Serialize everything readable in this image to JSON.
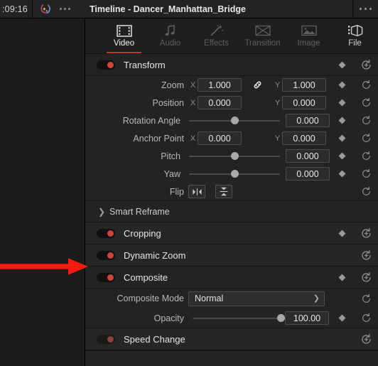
{
  "left_panel": {
    "timecode": ":09:16",
    "ai_icon": "magic-sparkle-icon",
    "options_icon": "ellipsis-icon"
  },
  "inspector": {
    "title": "Timeline - Dancer_Manhattan_Bridge",
    "header_options_icon": "ellipsis-icon",
    "tabs": [
      {
        "label": "Video",
        "icon": "film-strip-icon",
        "state": "active"
      },
      {
        "label": "Audio",
        "icon": "music-note-icon",
        "state": "disabled"
      },
      {
        "label": "Effects",
        "icon": "magic-wand-icon",
        "state": "disabled"
      },
      {
        "label": "Transition",
        "icon": "transition-icon",
        "state": "disabled"
      },
      {
        "label": "Image",
        "icon": "picture-icon",
        "state": "disabled"
      },
      {
        "label": "File",
        "icon": "file-clip-icon",
        "state": "enabled"
      }
    ],
    "sections": {
      "transform": {
        "title": "Transform",
        "enabled": true,
        "keyframe_icon": "diamond-keyframe-icon",
        "reset_icon": "reset-plus-icon",
        "rows": {
          "zoom": {
            "label": "Zoom",
            "x_axis": "X",
            "x_value": "1.000",
            "link_icon": "link-chain-icon",
            "y_axis": "Y",
            "y_value": "1.000",
            "keyframe_icon": "diamond-keyframe-icon",
            "reset_icon": "reset-icon"
          },
          "position": {
            "label": "Position",
            "x_axis": "X",
            "x_value": "0.000",
            "y_axis": "Y",
            "y_value": "0.000",
            "keyframe_icon": "diamond-keyframe-icon",
            "reset_icon": "reset-icon"
          },
          "rotation_angle": {
            "label": "Rotation Angle",
            "value": "0.000",
            "slider_percent": 50,
            "keyframe_icon": "diamond-keyframe-icon",
            "reset_icon": "reset-icon"
          },
          "anchor_point": {
            "label": "Anchor Point",
            "x_axis": "X",
            "x_value": "0.000",
            "y_axis": "Y",
            "y_value": "0.000",
            "keyframe_icon": "diamond-keyframe-icon",
            "reset_icon": "reset-icon"
          },
          "pitch": {
            "label": "Pitch",
            "value": "0.000",
            "slider_percent": 50,
            "keyframe_icon": "diamond-keyframe-icon",
            "reset_icon": "reset-icon"
          },
          "yaw": {
            "label": "Yaw",
            "value": "0.000",
            "slider_percent": 50,
            "keyframe_icon": "diamond-keyframe-icon",
            "reset_icon": "reset-icon"
          },
          "flip": {
            "label": "Flip",
            "horizontal_icon": "flip-horizontal-icon",
            "vertical_icon": "flip-vertical-icon",
            "reset_icon": "reset-icon"
          }
        }
      },
      "smart_reframe": {
        "title": "Smart Reframe",
        "collapsed": true,
        "chevron_icon": "chevron-right-icon"
      },
      "cropping": {
        "title": "Cropping",
        "enabled": true,
        "keyframe_icon": "diamond-keyframe-icon",
        "reset_icon": "reset-plus-icon"
      },
      "dynamic_zoom": {
        "title": "Dynamic Zoom",
        "enabled": true,
        "reset_icon": "reset-plus-icon"
      },
      "composite": {
        "title": "Composite",
        "enabled": true,
        "keyframe_icon": "diamond-keyframe-icon",
        "reset_icon": "reset-plus-icon",
        "rows": {
          "composite_mode": {
            "label": "Composite Mode",
            "value": "Normal",
            "caret_icon": "chevron-down-icon",
            "reset_icon": "reset-icon"
          },
          "opacity": {
            "label": "Opacity",
            "value": "100.00",
            "slider_percent": 100,
            "keyframe_icon": "diamond-keyframe-icon",
            "reset_icon": "reset-icon"
          }
        }
      },
      "speed_change": {
        "title": "Speed Change",
        "enabled": false,
        "reset_icon": "reset-plus-icon"
      }
    }
  },
  "annotation": {
    "arrow_icon": "red-pointer-arrow",
    "arrow_color": "#f51a12",
    "points_at": "Dynamic Zoom"
  },
  "colors": {
    "accent_red": "#c3362b",
    "toggle_on": "#d1453b",
    "toggle_off": "#8d3f39",
    "panel_bg": "#232323",
    "left_bg": "#1b1b1b",
    "field_bg": "#2b2b2b",
    "text_primary": "#e8e8e8",
    "text_secondary": "#b9b9b9",
    "text_muted": "#5e5e5e"
  }
}
